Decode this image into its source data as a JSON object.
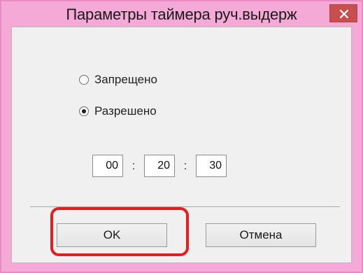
{
  "window": {
    "title": "Параметры таймера руч.выдерж",
    "close_icon": "close-icon"
  },
  "options": {
    "disabled_label": "Запрещено",
    "enabled_label": "Разрешено",
    "selected": "enabled"
  },
  "timer": {
    "hours": "00",
    "minutes": "20",
    "seconds": "30",
    "separator": ":"
  },
  "buttons": {
    "ok_label": "OK",
    "cancel_label": "Отмена"
  },
  "colors": {
    "frame": "#f5a9d6",
    "close_button": "#c7504f",
    "highlight": "#e02020"
  }
}
